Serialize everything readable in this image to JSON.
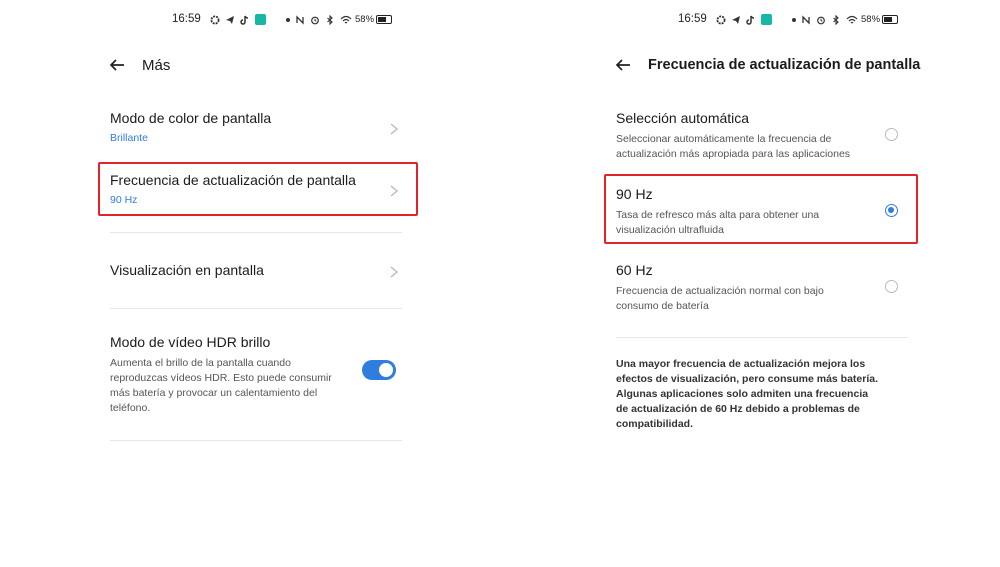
{
  "left_screen": {
    "status_bar": {
      "time": "16:59",
      "battery": "58%"
    },
    "header": {
      "title": "Más"
    },
    "items": [
      {
        "title": "Modo de color de pantalla",
        "value": "Brillante"
      },
      {
        "title": "Frecuencia de actualización de pantalla",
        "value": "90 Hz"
      },
      {
        "title": "Visualización en pantalla"
      },
      {
        "title": "Modo de vídeo HDR brillo",
        "description": "Aumenta el brillo de la pantalla cuando reproduzcas vídeos HDR. Esto puede consumir más batería y provocar un calentamiento del teléfono.",
        "toggle_on": true
      }
    ]
  },
  "right_screen": {
    "status_bar": {
      "time": "16:59",
      "battery": "58%"
    },
    "header": {
      "title": "Frecuencia de actualización de pantalla"
    },
    "options": [
      {
        "title": "Selección automática",
        "description": "Seleccionar automáticamente la frecuencia de actualización más apropiada para las aplicaciones",
        "selected": false
      },
      {
        "title": "90 Hz",
        "description": "Tasa de refresco más alta para obtener una visualización ultrafluida",
        "selected": true
      },
      {
        "title": "60 Hz",
        "description": "Frecuencia de actualización normal con bajo consumo de batería",
        "selected": false
      }
    ],
    "note": "Una mayor frecuencia de actualización mejora los efectos de visualización, pero consume más batería. Algunas aplicaciones solo admiten una frecuencia de actualización de 60 Hz debido a problemas de compatibilidad."
  },
  "colors": {
    "accent": "#2f7dde",
    "highlight": "#e3232a",
    "status_green": "#17b7a6"
  },
  "icons": [
    "back-arrow-icon",
    "chevron-right-icon",
    "radio-icon",
    "toggle-icon",
    "battery-icon",
    "wifi-icon",
    "bluetooth-icon",
    "alarm-icon",
    "nfc-icon"
  ]
}
